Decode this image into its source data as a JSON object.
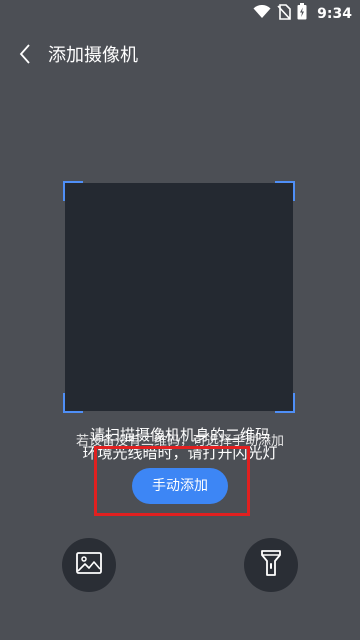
{
  "status_bar": {
    "time": "9:34",
    "icons": [
      "wifi-icon",
      "no-sim-icon",
      "battery-icon"
    ]
  },
  "header": {
    "back_icon": "chevron-left-icon",
    "title": "添加摄像机"
  },
  "scanner": {
    "hint": "若设备没有二维码，可选择手动添加",
    "instruction_line1": "请扫描摄像机机身的二维码",
    "instruction_line2": "环境光线暗时，请打开闪光灯"
  },
  "actions": {
    "manual_add_label": "手动添加",
    "gallery_icon": "image-icon",
    "flashlight_icon": "flashlight-icon"
  },
  "colors": {
    "background": "#4c4f55",
    "scan_area": "#242931",
    "accent": "#3d86f5",
    "highlight": "#e12020"
  }
}
